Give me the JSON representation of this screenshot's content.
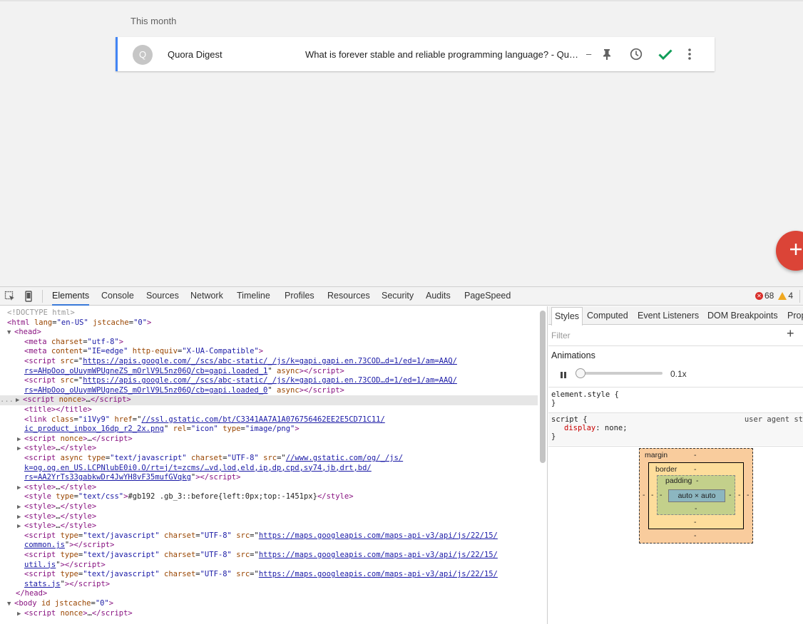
{
  "page": {
    "section_label": "This month",
    "card": {
      "avatar_letter": "Q",
      "sender": "Quora Digest",
      "subject": "What is forever stable and reliable programming language? - Qu…",
      "dash": "–",
      "icons": [
        "pin-icon",
        "snooze-clock-icon",
        "done-check-icon",
        "more-vert-icon"
      ],
      "accent_color": "#4285f4",
      "done_color": "#0f9d58"
    },
    "fab": {
      "icon": "plus-icon",
      "color": "#db4437"
    }
  },
  "devtools": {
    "tabs": [
      "Elements",
      "Console",
      "Sources",
      "Network",
      "Timeline",
      "Profiles",
      "Resources",
      "Security",
      "Audits",
      "PageSpeed"
    ],
    "active_tab": "Elements",
    "error_count": "68",
    "warning_count": "4",
    "elements_lines": {
      "l1": "<!DOCTYPE html>",
      "l2_tag": "<html",
      "l2_attr1": "lang",
      "l2_val1": "\"en-US\"",
      "l2_attr2": "jstcache",
      "l2_val2": "\"0\"",
      "l2_end": ">",
      "l3": "<head>",
      "meta1_a": "charset",
      "meta1_v": "\"utf-8\"",
      "meta2_a1": "content",
      "meta2_v1": "\"IE=edge\"",
      "meta2_a2": "http-equiv",
      "meta2_v2": "\"X-UA-Compatible\"",
      "script_link1a": "https://apis.google.com/_/scs/abc-static/_/js/k=gapi.gapi.en.73COD…d=1/ed=1/am=AAQ/",
      "script_link1b": "rs=AHpOoo_oUuymWPUgneZS_mOrlV9L5nz06Q/cb=gapi.loaded_1",
      "script_link2a": "https://apis.google.com/_/scs/abc-static/_/js/k=gapi.gapi.en.73COD…d=1/ed=1/am=AAQ/",
      "script_link2b": "rs=AHpOoo_oUuymWPUgneZS_mOrlV9L5nz06Q/cb=gapi.loaded_0",
      "link_href_a": "//ssl.gstatic.com/bt/C3341AA7A1A076756462EE2E5CD71C11/",
      "link_href_b": "ic_product_inbox_16dp_r2_2x.png",
      "og_href_a": "//www.gstatic.com/og/_/js/",
      "og_href_b": "k=og.og.en_US.LCPNlubE0i0.O/rt=j/t=zcms/…vd,lod,eld,ip,dp,cpd,sy74,jb,drt,bd/",
      "og_href_c": "rs=AA2YrTs33gabkwDr4JwYH8vF35mufGVqkg",
      "style_css": "#gb192 .gb_3::before{left:0px;top:-1451px}",
      "maps1a": "https://maps.googleapis.com/maps-api-v3/api/js/22/15/",
      "maps1b": "common.js",
      "maps2a": "https://maps.googleapis.com/maps-api-v3/api/js/22/15/",
      "maps2b": "util.js",
      "maps3a": "https://maps.googleapis.com/maps-api-v3/api/js/22/15/",
      "maps3b": "stats.js",
      "head_close": "</head>",
      "body_open": "<body",
      "body_attr": "id jstcache",
      "body_val": "\"0\""
    },
    "styles": {
      "tabs": [
        "Styles",
        "Computed",
        "Event Listeners",
        "DOM Breakpoints",
        "Prop"
      ],
      "active_tab": "Styles",
      "filter_placeholder": "Filter",
      "plus": "+",
      "animations_title": "Animations",
      "speed": "0.1x",
      "element_style": "element.style {",
      "close_brace": "}",
      "script_rule": "script {",
      "ua_label": "user agent st",
      "prop": "display",
      "prop_value": "none;",
      "box": {
        "margin": "margin",
        "border": "border",
        "padding": "padding",
        "dash": "-",
        "content": "auto × auto"
      }
    }
  }
}
